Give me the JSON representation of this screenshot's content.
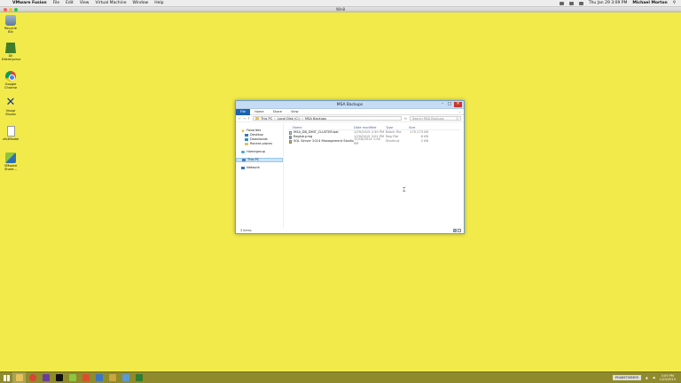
{
  "mac_menubar": {
    "app_name": "VMware Fusion",
    "menus": [
      "File",
      "Edit",
      "View",
      "Virtual Machine",
      "Window",
      "Help"
    ],
    "datetime": "Thu Jan 29  3:09 PM",
    "user": "Michael Morton"
  },
  "vm_window": {
    "title": "Win8"
  },
  "desktop": {
    "icons": [
      {
        "label": "Recycle Bin",
        "icon": "recycle-bin-icon"
      },
      {
        "label": "Dil Edemiyoruz",
        "icon": "dil-icon"
      },
      {
        "label": "Google Chrome",
        "icon": "chrome-icon"
      },
      {
        "label": "Visual Studio",
        "icon": "visual-studio-icon"
      },
      {
        "label": "vfs3Model",
        "icon": "document-icon"
      },
      {
        "label": "VMware Share...",
        "icon": "vmware-icon"
      }
    ]
  },
  "explorer": {
    "title": "MSA Backups",
    "ribbon_tabs": [
      "File",
      "Home",
      "Share",
      "View"
    ],
    "address": [
      "This PC",
      "Local Disk (C:)",
      "MSA Backups"
    ],
    "search_placeholder": "Search MSA Backups",
    "nav": [
      {
        "label": "Favorites",
        "icon": "star-icon",
        "level": 0
      },
      {
        "label": "Desktop",
        "icon": "desktop-icon",
        "level": 1
      },
      {
        "label": "Downloads",
        "icon": "downloads-icon",
        "level": 1
      },
      {
        "label": "Recent places",
        "icon": "recent-places-icon",
        "level": 1
      },
      {
        "label": "Homegroup",
        "icon": "homegroup-icon",
        "level": 0
      },
      {
        "label": "This PC",
        "icon": "pc-icon",
        "level": 0,
        "selected": true
      },
      {
        "label": "Network",
        "icon": "network-icon",
        "level": 0
      }
    ],
    "columns": {
      "name": "Name",
      "date": "Date modified",
      "type": "Type",
      "size": "Size"
    },
    "files": [
      {
        "name": "MSA_DB_DMIT_CLUSTER.bat",
        "date": "1/29/2015 2:50 PM",
        "type": "Batch File",
        "size": "175,173 KB",
        "icon": "batch-file-icon"
      },
      {
        "name": "Registry.reg",
        "date": "1/29/2015 3:01 PM",
        "type": "Reg File",
        "size": "6 KB",
        "icon": "reg-file-icon"
      },
      {
        "name": "SQL Server 2014 Management Studio",
        "date": "11/18/2014 1:00 PM",
        "type": "Shortcut",
        "size": "2 KB",
        "icon": "shortcut-icon"
      }
    ],
    "status": "3 items"
  },
  "taskbar": {
    "apps": [
      {
        "name": "file-explorer",
        "color": "#e8c25a"
      },
      {
        "name": "chrome",
        "color": "#db4437"
      },
      {
        "name": "visual-studio",
        "color": "#6a3d9a"
      },
      {
        "name": "command-prompt",
        "color": "#111111"
      },
      {
        "name": "vmware",
        "color": "#8cc63f"
      },
      {
        "name": "app-6",
        "color": "#d94f2b"
      },
      {
        "name": "app-7",
        "color": "#3a76c3"
      },
      {
        "name": "app-8",
        "color": "#c9a640"
      },
      {
        "name": "app-9",
        "color": "#5a9bd5"
      },
      {
        "name": "app-10",
        "color": "#2e7d32"
      }
    ],
    "ime": "PHABETIMMER",
    "clock_time": "3:09 PM",
    "clock_date": "1/29/2015"
  },
  "colors": {
    "desktop": "#f2ea4a",
    "taskbar": "#8f8a2c",
    "ribbon_file_tab": "#1a62b4",
    "close_button": "#c7372f"
  }
}
